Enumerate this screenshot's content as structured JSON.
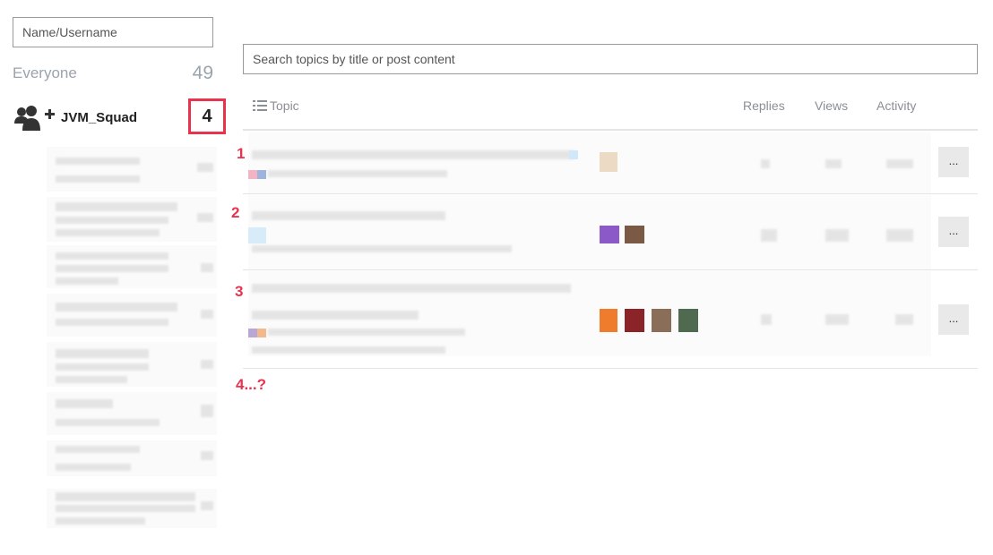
{
  "filter": {
    "name_placeholder": "Name/Username"
  },
  "everyone": {
    "label": "Everyone",
    "count": "49"
  },
  "group": {
    "name": "JVM_Squad",
    "count": "4",
    "icon": "user-group-plus-icon",
    "highlight_color": "#e8334f"
  },
  "search": {
    "placeholder": "Search topics by title or post content"
  },
  "table": {
    "columns": {
      "topic": "Topic",
      "replies": "Replies",
      "views": "Views",
      "activity": "Activity"
    },
    "topic_icon": "list-icon",
    "more_label": "..."
  },
  "annotations": {
    "row1": "1",
    "row2": "2",
    "row3": "3",
    "more": "4...?"
  },
  "colors": {
    "accent": "#e8334f",
    "muted": "#9ba3ad"
  }
}
